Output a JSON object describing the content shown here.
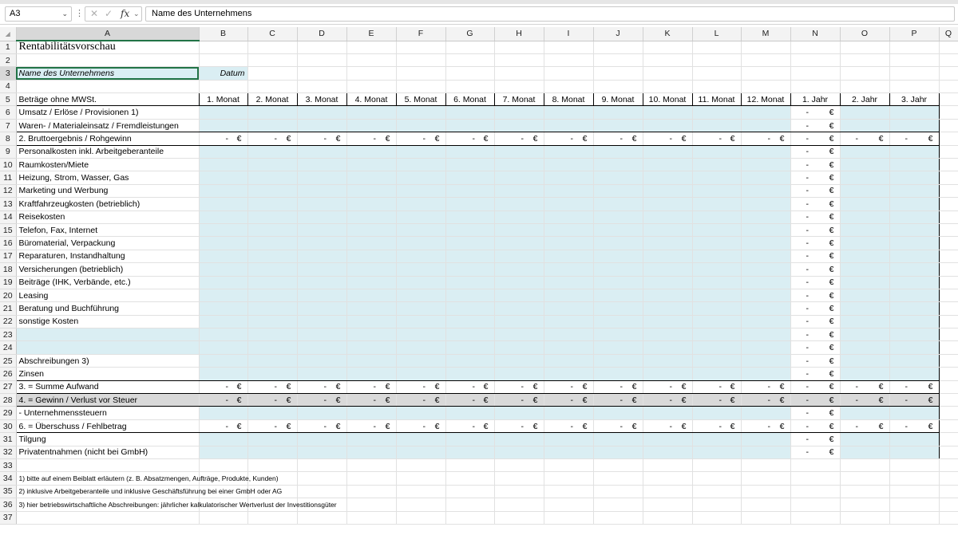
{
  "formula_bar": {
    "cell_ref": "A3",
    "content": "Name des Unternehmens"
  },
  "columns": [
    "A",
    "B",
    "C",
    "D",
    "E",
    "F",
    "G",
    "H",
    "I",
    "J",
    "K",
    "L",
    "M",
    "N",
    "O",
    "P",
    "Q"
  ],
  "sheet": {
    "title": "Rentabilitätsvorschau",
    "company_placeholder": "Name des Unternehmens",
    "date_label": "Datum",
    "header_label": "Beträge ohne MWSt.",
    "period_headers": [
      "1. Monat",
      "2. Monat",
      "3. Monat",
      "4. Monat",
      "5. Monat",
      "6. Monat",
      "7. Monat",
      "8. Monat",
      "9. Monat",
      "10. Monat",
      "11. Monat",
      "12. Monat",
      "1. Jahr",
      "2. Jahr",
      "3. Jahr"
    ],
    "dash": "-",
    "currency": "€",
    "rows": {
      "r6": "Umsatz / Erlöse / Provisionen 1)",
      "r7": "Waren- / Materialeinsatz / Fremdleistungen",
      "r8": "2. Bruttoergebnis / Rohgewinn",
      "r9": "Personalkosten inkl. Arbeitgeberanteile",
      "r10": "Raumkosten/Miete",
      "r11": "Heizung, Strom, Wasser, Gas",
      "r12": "Marketing und Werbung",
      "r13": "Kraftfahrzeugkosten (betrieblich)",
      "r14": "Reisekosten",
      "r15": "Telefon, Fax, Internet",
      "r16": "Büromaterial, Verpackung",
      "r17": "Reparaturen, Instandhaltung",
      "r18": "Versicherungen (betrieblich)",
      "r19": "Beiträge (IHK, Verbände, etc.)",
      "r20": "Leasing",
      "r21": "Beratung und Buchführung",
      "r22": "sonstige Kosten",
      "r25": "Abschreibungen 3)",
      "r26": "Zinsen",
      "r27": "3. = Summe Aufwand",
      "r28": "4. = Gewinn / Verlust vor Steuer",
      "r29": "- Unternehmenssteuern",
      "r30": "6. = Überschuss / Fehlbetrag",
      "r31": "Tilgung",
      "r32": "Privatentnahmen (nicht bei GmbH)"
    },
    "footnotes": {
      "f1": "1) bitte auf einem Beiblatt erläutern (z. B. Absatzmengen, Aufträge, Produkte, Kunden)",
      "f2": "2) inklusive Arbeitgeberanteile und inklusive Geschäftsführung bei einer GmbH oder AG",
      "f3": "3) hier betriebswirtschaftliche Abschreibungen: jährlicher kalkulatorischer Wertverlust der Investitionsgüter"
    }
  },
  "colors": {
    "input_fill": "#daeef3",
    "total_fill": "#d9d9d9",
    "selection_green": "#217346"
  }
}
